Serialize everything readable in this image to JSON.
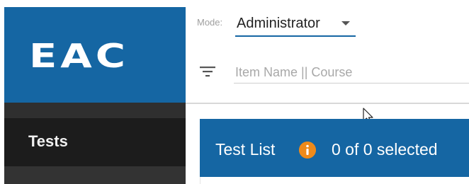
{
  "sidebar": {
    "logo_text": "EAC",
    "nav_items": [
      {
        "label": "Tests",
        "icon": "none"
      }
    ]
  },
  "header": {
    "mode_label": "Mode:",
    "mode_value": "Administrator",
    "search_placeholder": "Item Name || Course",
    "search_value": ""
  },
  "test_list": {
    "title": "Test List",
    "info_icon": "info-icon",
    "selection_text": "0 of 0 selected"
  },
  "colors": {
    "brand_blue": "#1566a3",
    "sidebar_dark": "#2b2b2b",
    "info_orange": "#ee8a1a"
  }
}
